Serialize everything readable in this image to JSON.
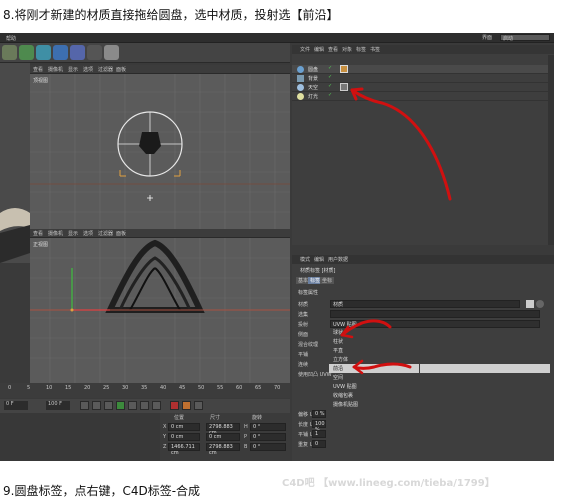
{
  "captions": {
    "top": "8.将刚才新建的材质直接拖给圆盘，选中材质，投射选【前沿】",
    "bottom": "9.圆盘标签，点右键，C4D标签-合成"
  },
  "watermark": "C4D吧 【www.lineeg.com/tieba/1799】",
  "app": {
    "title": "帮助",
    "layout_label": "界面",
    "layout_value": "启动",
    "viewport_top": {
      "menu": [
        "查看",
        "摄像机",
        "显示",
        "选项",
        "过滤器",
        "面板"
      ],
      "name": "顶视图"
    },
    "viewport_bottom": {
      "menu": [
        "查看",
        "摄像机",
        "显示",
        "选项",
        "过滤器",
        "面板"
      ],
      "name": "正视图"
    },
    "object_manager": {
      "menu": [
        "文件",
        "编辑",
        "查看",
        "对象",
        "标签",
        "书签"
      ],
      "rows": [
        "圆盘",
        "背景",
        "天空",
        "灯光"
      ]
    },
    "attribute_manager": {
      "menu": [
        "模式",
        "编辑",
        "用户数据"
      ],
      "header": "材质标签 [材质]",
      "tabs": [
        "基本",
        "标签",
        "坐标"
      ],
      "section": "标签属性",
      "fields": [
        {
          "label": "材质",
          "value": "材质"
        },
        {
          "label": "选集",
          "value": ""
        },
        {
          "label": "投射",
          "value": "UVW 贴图"
        },
        {
          "label": "侧面",
          "value": ""
        },
        {
          "label": "混合纹理",
          "value": ""
        },
        {
          "label": "平铺",
          "value": ""
        },
        {
          "label": "连续",
          "value": ""
        },
        {
          "label": "使用凹凸 UVW",
          "value": ""
        },
        {
          "label": "偏移 U",
          "value": "0 %"
        },
        {
          "label": "长度 U",
          "value": "100 %"
        },
        {
          "label": "平铺 U",
          "value": "1"
        },
        {
          "label": "重复 U",
          "value": "0"
        }
      ],
      "projection_options": [
        "球状",
        "柱状",
        "平直",
        "立方体",
        "前沿",
        "空间",
        "UVW 贴图",
        "收缩包裹",
        "摄像机贴图"
      ]
    },
    "timeline": {
      "ticks": [
        "0",
        "5",
        "10",
        "15",
        "20",
        "25",
        "30",
        "35",
        "40",
        "45",
        "50",
        "55",
        "60",
        "65",
        "70"
      ],
      "frame": "0 F",
      "end_frame": "100 F"
    },
    "coords": {
      "headers": [
        "位置",
        "尺寸",
        "旋转"
      ],
      "rows": [
        {
          "axis": "X",
          "pos": "0 cm",
          "size": "2798.883 cm",
          "rot_axis": "H",
          "rot": "0 °"
        },
        {
          "axis": "Y",
          "pos": "0 cm",
          "size": "0 cm",
          "rot_axis": "P",
          "rot": "0 °"
        },
        {
          "axis": "Z",
          "pos": "1466.711 cm",
          "size": "2798.883 cm",
          "rot_axis": "B",
          "rot": "0 °"
        }
      ]
    }
  }
}
